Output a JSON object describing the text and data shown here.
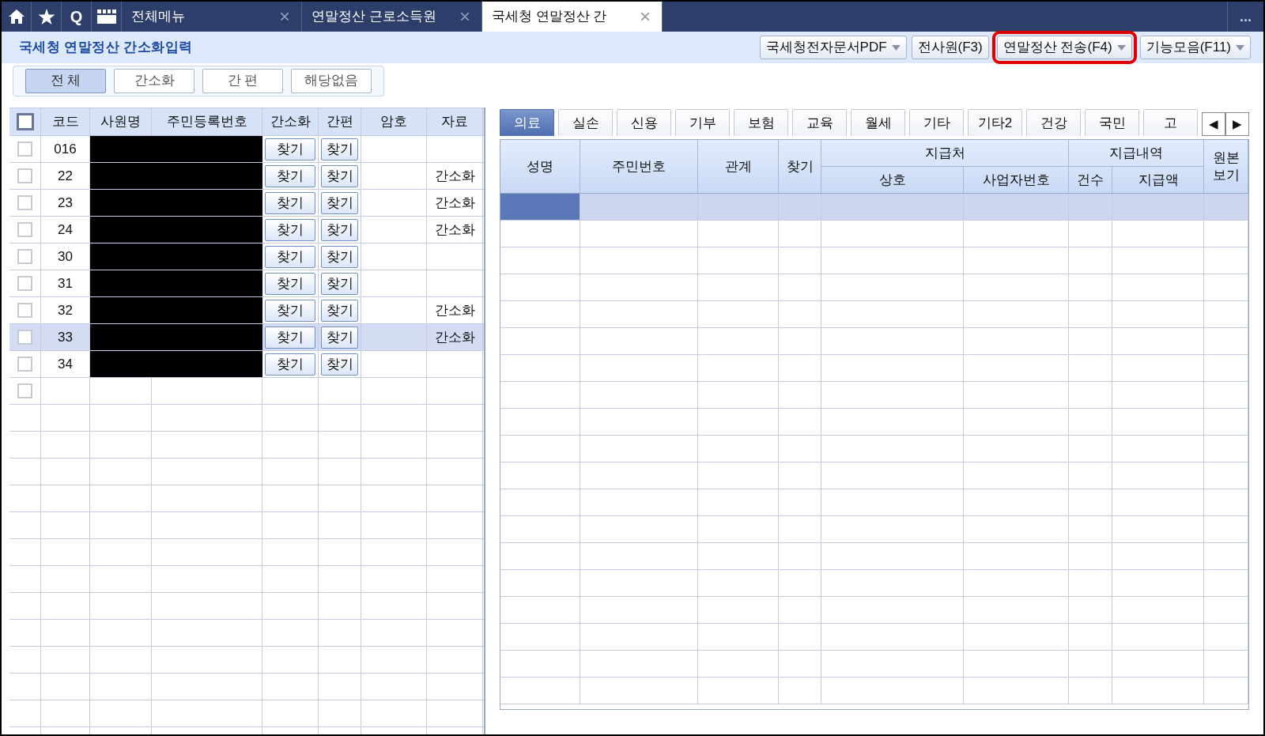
{
  "top_bar": {
    "quick_icons": [
      {
        "kind": "home"
      },
      {
        "kind": "star"
      },
      {
        "kind": "letter",
        "text": "Q"
      },
      {
        "kind": "clapper"
      }
    ],
    "tabs": [
      {
        "label": "전체메뉴",
        "selected": false,
        "close": "×"
      },
      {
        "label": "연말정산 근로소득원",
        "selected": false,
        "close": "×"
      },
      {
        "label": "국세청 연말정산 간",
        "selected": true,
        "close": "×"
      }
    ],
    "more": "..."
  },
  "page_title": "국세청 연말정산 간소화입력",
  "header_buttons": [
    {
      "label": "국세청전자문서PDF",
      "kind": "dropdown",
      "highlighted": false
    },
    {
      "label": "전사원(F3)",
      "kind": "button",
      "highlighted": false
    },
    {
      "label": "연말정산 전송(F4)",
      "kind": "dropdown",
      "highlighted": true
    },
    {
      "label": "기능모음(F11)",
      "kind": "dropdown",
      "highlighted": false
    }
  ],
  "filter_buttons": [
    {
      "label": "전 체",
      "selected": true
    },
    {
      "label": "간소화",
      "selected": false
    },
    {
      "label": "간 편",
      "selected": false
    },
    {
      "label": "해당없음",
      "selected": false
    }
  ],
  "employee_table": {
    "header_checked": false,
    "columns": [
      "코드",
      "사원명",
      "주민등록번호",
      "간소화",
      "간편",
      "암호",
      "자료"
    ],
    "rows": [
      {
        "checked": false,
        "selected": false,
        "code": "016",
        "redacted": true,
        "simple_find": "찾기",
        "easy_find": "찾기",
        "data": ""
      },
      {
        "checked": false,
        "selected": false,
        "code": "22",
        "redacted": true,
        "simple_find": "찾기",
        "easy_find": "찾기",
        "data": "간소화"
      },
      {
        "checked": false,
        "selected": false,
        "code": "23",
        "redacted": true,
        "simple_find": "찾기",
        "easy_find": "찾기",
        "data": "간소화"
      },
      {
        "checked": false,
        "selected": false,
        "code": "24",
        "redacted": true,
        "simple_find": "찾기",
        "easy_find": "찾기",
        "data": "간소화"
      },
      {
        "checked": false,
        "selected": false,
        "code": "30",
        "redacted": true,
        "simple_find": "찾기",
        "easy_find": "찾기",
        "data": ""
      },
      {
        "checked": false,
        "selected": false,
        "code": "31",
        "redacted": true,
        "simple_find": "찾기",
        "easy_find": "찾기",
        "data": ""
      },
      {
        "checked": false,
        "selected": false,
        "code": "32",
        "redacted": true,
        "simple_find": "찾기",
        "easy_find": "찾기",
        "data": "간소화"
      },
      {
        "checked": false,
        "selected": true,
        "code": "33",
        "redacted": true,
        "simple_find": "찾기",
        "easy_find": "찾기",
        "data": "간소화"
      },
      {
        "checked": false,
        "selected": false,
        "code": "34",
        "redacted": true,
        "simple_find": "찾기",
        "easy_find": "찾기",
        "data": ""
      },
      {
        "checked": false,
        "selected": false,
        "code": "",
        "redacted": false,
        "simple_find": "",
        "easy_find": "",
        "data": ""
      }
    ]
  },
  "category_tabs": [
    {
      "label": "의료",
      "selected": true
    },
    {
      "label": "실손",
      "selected": false
    },
    {
      "label": "신용",
      "selected": false
    },
    {
      "label": "기부",
      "selected": false
    },
    {
      "label": "보험",
      "selected": false
    },
    {
      "label": "교육",
      "selected": false
    },
    {
      "label": "월세",
      "selected": false
    },
    {
      "label": "기타",
      "selected": false
    },
    {
      "label": "기타2",
      "selected": false
    },
    {
      "label": "건강",
      "selected": false
    },
    {
      "label": "국민",
      "selected": false
    },
    {
      "label": "고",
      "selected": false
    }
  ],
  "scroll_arrows": [
    "◀",
    "▶"
  ],
  "detail_table": {
    "columns": [
      {
        "label": "성명"
      },
      {
        "label": "주민번호"
      },
      {
        "label": "관계"
      },
      {
        "label": "찾기"
      },
      {
        "label": "지급처",
        "children": [
          {
            "label": "상호"
          },
          {
            "label": "사업자번호"
          }
        ]
      },
      {
        "label": "지급내역",
        "children": [
          {
            "label": "건수"
          },
          {
            "label": "지급액"
          }
        ]
      },
      {
        "label": "원본\n보기"
      }
    ],
    "selected_row": true
  }
}
